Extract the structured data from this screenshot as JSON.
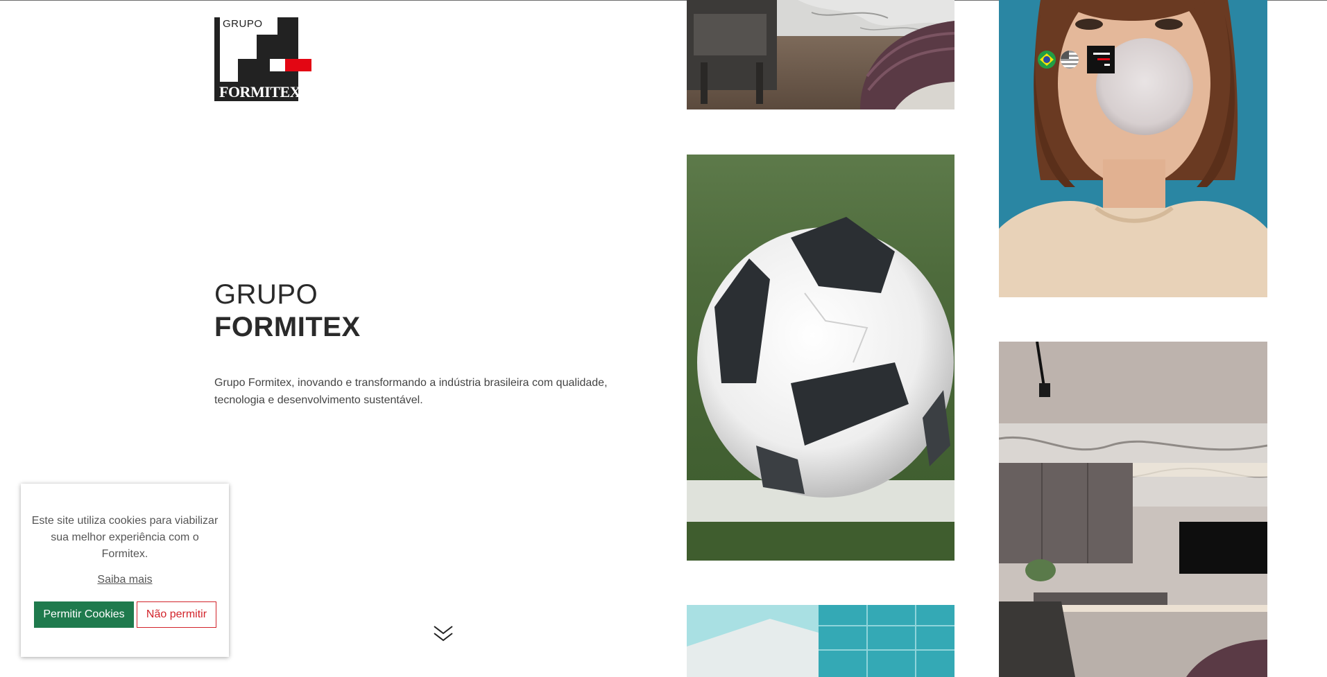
{
  "logo": {
    "top_word": "GRUPO",
    "bottom_word": "FORMITEX"
  },
  "hero": {
    "title_line1": "GRUPO",
    "title_line2": "FORMITEX",
    "description": "Grupo Formitex, inovando e transformando a indústria brasileira com qualidade, tecnologia e desenvolvimento sustentável."
  },
  "header": {
    "languages": [
      {
        "icon": "brazil-flag-icon"
      },
      {
        "icon": "usa-flag-icon"
      }
    ],
    "menu_icon": "menu-icon"
  },
  "cookie_banner": {
    "text": "Este site utiliza cookies para viabilizar sua melhor experiência com o Formitex.",
    "learn_more": "Saiba mais",
    "allow_button": "Permitir Cookies",
    "deny_button": "Não permitir"
  },
  "colors": {
    "brand_red": "#e30613",
    "brand_black": "#222222",
    "allow_green": "#1f7a4d",
    "deny_red": "#d2232a"
  },
  "scroll_icon": "chevron-double-down-icon"
}
